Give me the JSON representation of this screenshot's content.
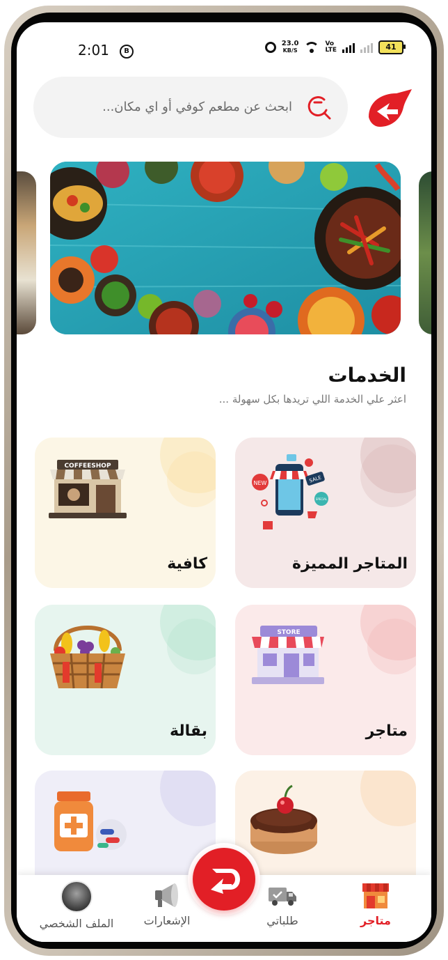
{
  "status_bar": {
    "time": "2:01",
    "badge": "B",
    "net_speed_value": "23.0",
    "net_speed_unit": "KB/S",
    "volte_top": "Vo",
    "volte_bottom": "LTE",
    "battery": "41"
  },
  "header": {
    "search_placeholder": "ابحث عن مطعم كوفي أو اي مكان..."
  },
  "services": {
    "title": "الخدمات",
    "subtitle": "اعثر علي الخدمة اللي تريدها بكل سهولة ...",
    "cards": [
      {
        "label": "المتاجر المميزة",
        "color": "#f5e8e8",
        "icon": "phone-shop-icon"
      },
      {
        "label": "كافية",
        "color": "#fcf6e6",
        "icon": "coffeeshop-icon"
      },
      {
        "label": "متاجر",
        "color": "#fbeaea",
        "icon": "store-icon"
      },
      {
        "label": "بقالة",
        "color": "#e7f5ef",
        "icon": "grocery-basket-icon"
      },
      {
        "label": "",
        "color": "#fcf1e6",
        "icon": "cake-icon"
      },
      {
        "label": "",
        "color": "#efeef8",
        "icon": "pharmacy-icon"
      }
    ],
    "shop_sign": "COFFEESHOP",
    "store_sign": "STORE",
    "sale_tags": [
      "NEW",
      "SALE",
      "SPECIAL"
    ]
  },
  "bottom_nav": {
    "items": [
      {
        "label": "الملف الشخصي",
        "icon": "profile-avatar"
      },
      {
        "label": "الإشعارات",
        "icon": "megaphone-icon"
      },
      {
        "label": "طلباتي",
        "icon": "delivery-truck-icon"
      },
      {
        "label": "متاجر",
        "icon": "store-awning-icon"
      }
    ],
    "active_index": 3
  },
  "colors": {
    "brand": "#e21f26",
    "active_tab": "#e21f26"
  }
}
